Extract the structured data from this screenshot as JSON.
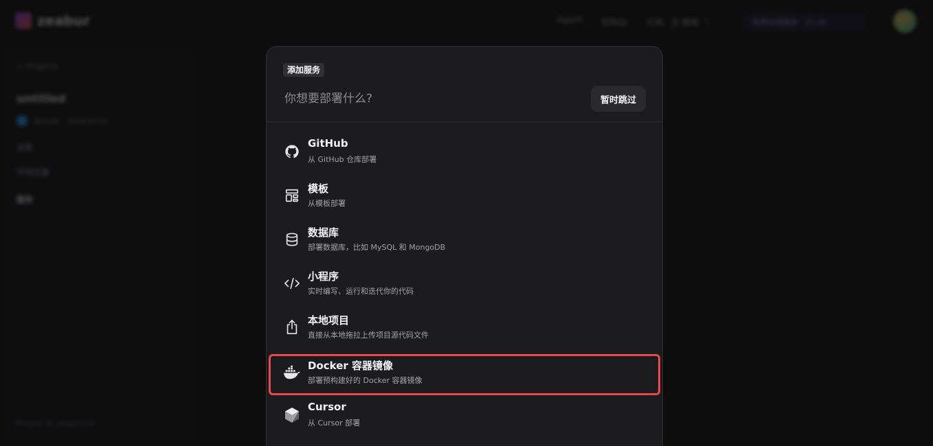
{
  "background": {
    "logo_text": "zeabur",
    "nav": [
      "Agent",
      "控制台",
      "文档",
      "模板"
    ],
    "credits_text": "免费试用额度 · $5.00",
    "sidebar": {
      "back": "< Projects",
      "project_name": "untitled",
      "owner": "default · Datacenter",
      "items": [
        "设置",
        "环境变量"
      ],
      "section": "服务",
      "footer": "Project ID: project-id"
    }
  },
  "modal": {
    "tag": "添加服务",
    "search_placeholder": "你想要部署什么?",
    "skip_label": "暂时跳过",
    "options": [
      {
        "title": "GitHub",
        "subtitle": "从 GitHub 仓库部署",
        "icon": "github-icon",
        "highlighted": false
      },
      {
        "title": "模板",
        "subtitle": "从模板部署",
        "icon": "template-icon",
        "highlighted": false
      },
      {
        "title": "数据库",
        "subtitle": "部署数据库，比如 MySQL 和 MongoDB",
        "icon": "database-icon",
        "highlighted": false
      },
      {
        "title": "小程序",
        "subtitle": "实时编写、运行和迭代你的代码",
        "icon": "code-icon",
        "highlighted": false
      },
      {
        "title": "本地项目",
        "subtitle": "直接从本地拖拉上传项目源代码文件",
        "icon": "upload-icon",
        "highlighted": false
      },
      {
        "title": "Docker 容器镜像",
        "subtitle": "部署预构建好的 Docker 容器镜像",
        "icon": "docker-icon",
        "highlighted": true
      },
      {
        "title": "Cursor",
        "subtitle": "从 Cursor 部署",
        "icon": "cursor-icon",
        "highlighted": false
      }
    ]
  },
  "colors": {
    "highlight_border": "#e8494f",
    "modal_bg": "#1c1c1f",
    "page_bg": "#141416"
  }
}
